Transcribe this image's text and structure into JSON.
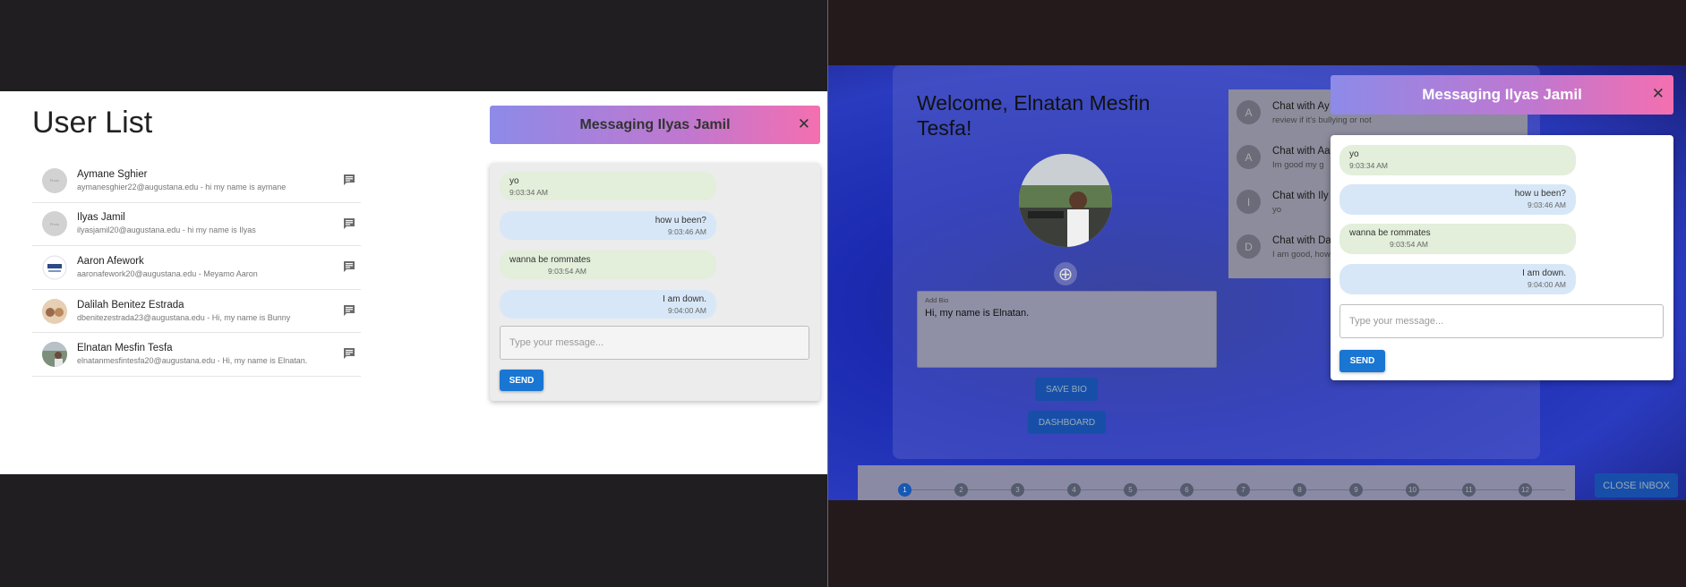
{
  "left": {
    "title": "User List",
    "users": [
      {
        "name": "Aymane Sghier",
        "subtitle": "aymanesghier22@augustana.edu - hi my name is aymane"
      },
      {
        "name": "Ilyas Jamil",
        "subtitle": "ilyasjamil20@augustana.edu - hi my name is Ilyas"
      },
      {
        "name": "Aaron Afework",
        "subtitle": "aaronafework20@augustana.edu - Meyamo Aaron"
      },
      {
        "name": "Dalilah Benitez Estrada",
        "subtitle": "dbenitezestrada23@augustana.edu - Hi, my name is Bunny"
      },
      {
        "name": "Elnatan Mesfin Tesfa",
        "subtitle": "elnatanmesfintesfa20@augustana.edu - Hi, my name is Elnatan."
      }
    ],
    "avatar_placeholder": "Photo",
    "chat": {
      "header": "Messaging Ilyas Jamil",
      "close_glyph": "✕",
      "messages": [
        {
          "text": "yo",
          "time": "9:03:34 AM"
        },
        {
          "text": "how u been?",
          "time": "9:03:46 AM"
        },
        {
          "text": "wanna be rommates",
          "time": "9:03:54 AM"
        },
        {
          "text": "I am down.",
          "time": "9:04:00 AM"
        }
      ],
      "input_placeholder": "Type your message...",
      "send_label": "SEND"
    }
  },
  "right": {
    "welcome": "Welcome, Elnatan Mesfin Tesfa!",
    "add_photo_glyph": "⊕",
    "bio_label": "Add Bio",
    "bio_text": "Hi, my name is Elnatan.",
    "save_bio_label": "SAVE BIO",
    "dashboard_label": "DASHBOARD",
    "inbox": [
      {
        "initial": "A",
        "title": "Chat with Ay",
        "subtitle": "review if it's bullying or not"
      },
      {
        "initial": "A",
        "title": "Chat with Aa",
        "subtitle": "Im good my g"
      },
      {
        "initial": "I",
        "title": "Chat with Ily",
        "subtitle": "yo"
      },
      {
        "initial": "D",
        "title": "Chat with Da",
        "subtitle": "I am good, how"
      }
    ],
    "steps": [
      "1",
      "2",
      "3",
      "4",
      "5",
      "6",
      "7",
      "8",
      "9",
      "10",
      "11",
      "12"
    ],
    "active_step": "1",
    "close_inbox_label": "CLOSE INBOX",
    "chat": {
      "header": "Messaging Ilyas Jamil",
      "close_glyph": "✕",
      "messages": [
        {
          "text": "yo",
          "time": "9:03:34 AM"
        },
        {
          "text": "how u been?",
          "time": "9:03:46 AM"
        },
        {
          "text": "wanna be rommates",
          "time": "9:03:54 AM"
        },
        {
          "text": "I am down.",
          "time": "9:04:00 AM"
        }
      ],
      "input_placeholder": "Type your message...",
      "send_label": "SEND"
    }
  },
  "colors": {
    "accent": "#1976d2",
    "gradient_start": "#8d8ae8",
    "gradient_end": "#f46fb0",
    "sent_bubble": "#e3eedb",
    "received_bubble": "#d7e7f7"
  }
}
